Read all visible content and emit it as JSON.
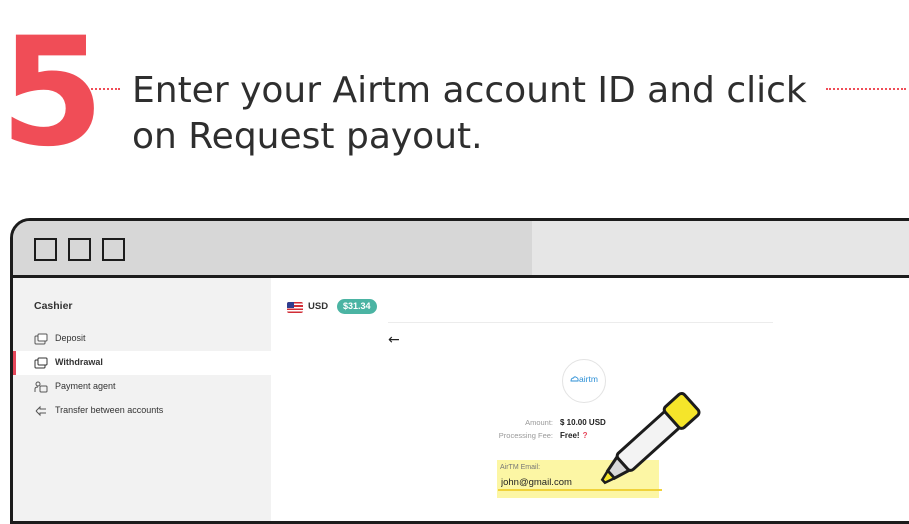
{
  "step": {
    "number": "5",
    "instruction": "Enter your Airtm account ID and click on Request payout."
  },
  "browser": {
    "window_buttons": [
      "square",
      "square",
      "square"
    ]
  },
  "sidebar": {
    "title": "Cashier",
    "items": [
      {
        "label": "Deposit",
        "icon": "deposit-icon",
        "active": false
      },
      {
        "label": "Withdrawal",
        "icon": "withdrawal-icon",
        "active": true
      },
      {
        "label": "Payment agent",
        "icon": "payment-agent-icon",
        "active": false
      },
      {
        "label": "Transfer between accounts",
        "icon": "transfer-icon",
        "active": false
      }
    ]
  },
  "account": {
    "currency": "USD",
    "balance": "$31.34",
    "flag": "us-flag-icon"
  },
  "payment": {
    "provider_logo": "airtm",
    "amount_label": "Amount:",
    "amount_value": "$ 10.00 USD",
    "fee_label": "Processing Fee:",
    "fee_value": "Free!",
    "fee_help": "?",
    "email_label": "AirTM Email:",
    "email_value": "john@gmail.com"
  },
  "colors": {
    "accent": "#f04d57",
    "balance_badge": "#4bb4a3",
    "highlight": "#fcf6a4",
    "airtm_blue": "#2b8fd6"
  }
}
